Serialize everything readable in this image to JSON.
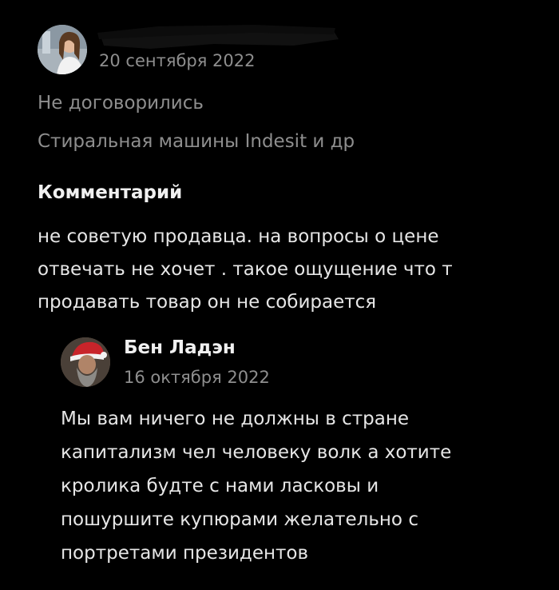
{
  "review": {
    "date": "20 сентября 2022",
    "deal_status": "Не договорились",
    "item_title": "Стиральная машины Indesit и др",
    "comment_heading": "Комментарий",
    "comment_lines": [
      "не советую продавца. на вопросы о цене",
      "отвечать не хочет . такое ощущение что т",
      "продавать товар он не собирается"
    ]
  },
  "reply": {
    "author": "Бен Ладэн",
    "date": "16 октября 2022",
    "lines": [
      "Мы вам ничего не должны в стране",
      "капитализм чел человеку волк а хотите",
      "кролика будте с нами ласковы и",
      "пошуршите купюрами желательно с",
      "портретами президентов"
    ]
  },
  "colors": {
    "background": "#000000",
    "primary_text": "#e6e6e6",
    "secondary_text": "#8e8e8e"
  }
}
